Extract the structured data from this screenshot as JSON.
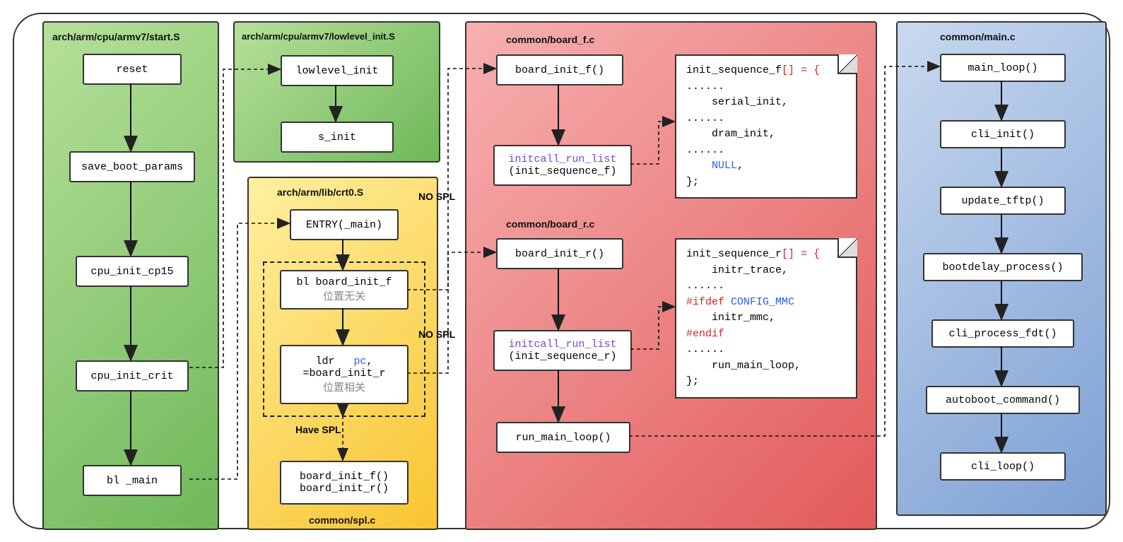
{
  "groups": {
    "startS": {
      "title": "arch/arm/cpu/armv7/start.S"
    },
    "lowlevel": {
      "title": "arch/arm/cpu/armv7/lowlevel_init.S"
    },
    "crt0": {
      "title": "arch/arm/lib/crt0.S"
    },
    "board_f": {
      "title": "common/board_f.c"
    },
    "board_r": {
      "title": "common/board_r.c"
    },
    "main": {
      "title": "common/main.c"
    },
    "spl_footer": "common/spl.c"
  },
  "startS_boxes": {
    "reset": "reset",
    "save_boot_params": "save_boot_params",
    "cpu_init_cp15": "cpu_init_cp15",
    "cpu_init_crit": "cpu_init_crit",
    "bl_main": "bl _main"
  },
  "lowlevel_boxes": {
    "lowlevel_init": "lowlevel_init",
    "s_init": "s_init"
  },
  "crt0_boxes": {
    "entry": "ENTRY(_main)",
    "bif_line1": "bl board_init_f",
    "bif_line2": "位置无关",
    "ldr_line1a": "ldr   ",
    "ldr_line1b": "pc",
    "ldr_line1c": ",",
    "ldr_line2": "=board_init_r",
    "ldr_line3": "位置相关",
    "spl_box": "board_init_f()\nboard_init_r()"
  },
  "red_boxes": {
    "board_init_f": "board_init_f()",
    "initcall_f_l1": "initcall_run_list",
    "initcall_f_l2": "(init_sequence_f)",
    "board_init_r": "board_init_r()",
    "initcall_r_l1": "initcall_run_list",
    "initcall_r_l2": "(init_sequence_r)",
    "run_main_loop": "run_main_loop()"
  },
  "note_f": {
    "l1a": "init_sequence_f",
    "l1b": "[] = {",
    "l2": "......",
    "l3": "    serial_init,",
    "l4": "......",
    "l5": "    dram_init,",
    "l6": "......",
    "l7": "    ",
    "l7b": "NULL",
    "l7c": ",",
    "l8": "};"
  },
  "note_r": {
    "l1a": "init_sequence_r",
    "l1b": "[] = {",
    "l2": "    initr_trace,",
    "l3": "......",
    "l4a": "#ifdef",
    "l4b": " CONFIG_MMC",
    "l5": "    initr_mmc,",
    "l6": "#endif",
    "l7": "......",
    "l8": "    run_main_loop,",
    "l9": "};"
  },
  "blue_boxes": {
    "main_loop": "main_loop()",
    "cli_init": "cli_init()",
    "update_tftp": "update_tftp()",
    "bootdelay": "bootdelay_process()",
    "cli_process_fdt": "cli_process_fdt()",
    "autoboot": "autoboot_command()",
    "cli_loop": "cli_loop()"
  },
  "labels": {
    "nospl": "NO SPL",
    "havespl": "Have SPL"
  }
}
